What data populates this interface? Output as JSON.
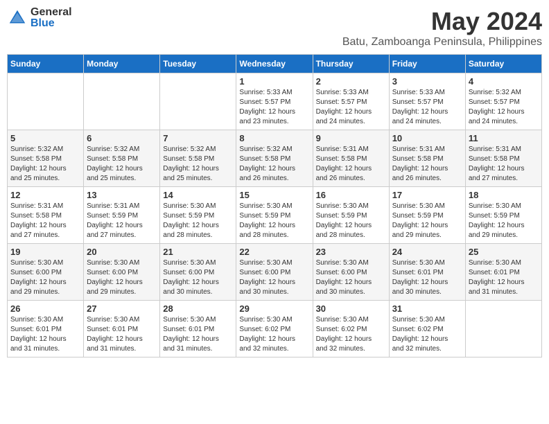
{
  "header": {
    "logo_general": "General",
    "logo_blue": "Blue",
    "month_year": "May 2024",
    "location": "Batu, Zamboanga Peninsula, Philippines"
  },
  "days_of_week": [
    "Sunday",
    "Monday",
    "Tuesday",
    "Wednesday",
    "Thursday",
    "Friday",
    "Saturday"
  ],
  "weeks": [
    [
      {
        "day": "",
        "info": ""
      },
      {
        "day": "",
        "info": ""
      },
      {
        "day": "",
        "info": ""
      },
      {
        "day": "1",
        "info": "Sunrise: 5:33 AM\nSunset: 5:57 PM\nDaylight: 12 hours\nand 23 minutes."
      },
      {
        "day": "2",
        "info": "Sunrise: 5:33 AM\nSunset: 5:57 PM\nDaylight: 12 hours\nand 24 minutes."
      },
      {
        "day": "3",
        "info": "Sunrise: 5:33 AM\nSunset: 5:57 PM\nDaylight: 12 hours\nand 24 minutes."
      },
      {
        "day": "4",
        "info": "Sunrise: 5:32 AM\nSunset: 5:57 PM\nDaylight: 12 hours\nand 24 minutes."
      }
    ],
    [
      {
        "day": "5",
        "info": "Sunrise: 5:32 AM\nSunset: 5:58 PM\nDaylight: 12 hours\nand 25 minutes."
      },
      {
        "day": "6",
        "info": "Sunrise: 5:32 AM\nSunset: 5:58 PM\nDaylight: 12 hours\nand 25 minutes."
      },
      {
        "day": "7",
        "info": "Sunrise: 5:32 AM\nSunset: 5:58 PM\nDaylight: 12 hours\nand 25 minutes."
      },
      {
        "day": "8",
        "info": "Sunrise: 5:32 AM\nSunset: 5:58 PM\nDaylight: 12 hours\nand 26 minutes."
      },
      {
        "day": "9",
        "info": "Sunrise: 5:31 AM\nSunset: 5:58 PM\nDaylight: 12 hours\nand 26 minutes."
      },
      {
        "day": "10",
        "info": "Sunrise: 5:31 AM\nSunset: 5:58 PM\nDaylight: 12 hours\nand 26 minutes."
      },
      {
        "day": "11",
        "info": "Sunrise: 5:31 AM\nSunset: 5:58 PM\nDaylight: 12 hours\nand 27 minutes."
      }
    ],
    [
      {
        "day": "12",
        "info": "Sunrise: 5:31 AM\nSunset: 5:58 PM\nDaylight: 12 hours\nand 27 minutes."
      },
      {
        "day": "13",
        "info": "Sunrise: 5:31 AM\nSunset: 5:59 PM\nDaylight: 12 hours\nand 27 minutes."
      },
      {
        "day": "14",
        "info": "Sunrise: 5:30 AM\nSunset: 5:59 PM\nDaylight: 12 hours\nand 28 minutes."
      },
      {
        "day": "15",
        "info": "Sunrise: 5:30 AM\nSunset: 5:59 PM\nDaylight: 12 hours\nand 28 minutes."
      },
      {
        "day": "16",
        "info": "Sunrise: 5:30 AM\nSunset: 5:59 PM\nDaylight: 12 hours\nand 28 minutes."
      },
      {
        "day": "17",
        "info": "Sunrise: 5:30 AM\nSunset: 5:59 PM\nDaylight: 12 hours\nand 29 minutes."
      },
      {
        "day": "18",
        "info": "Sunrise: 5:30 AM\nSunset: 5:59 PM\nDaylight: 12 hours\nand 29 minutes."
      }
    ],
    [
      {
        "day": "19",
        "info": "Sunrise: 5:30 AM\nSunset: 6:00 PM\nDaylight: 12 hours\nand 29 minutes."
      },
      {
        "day": "20",
        "info": "Sunrise: 5:30 AM\nSunset: 6:00 PM\nDaylight: 12 hours\nand 29 minutes."
      },
      {
        "day": "21",
        "info": "Sunrise: 5:30 AM\nSunset: 6:00 PM\nDaylight: 12 hours\nand 30 minutes."
      },
      {
        "day": "22",
        "info": "Sunrise: 5:30 AM\nSunset: 6:00 PM\nDaylight: 12 hours\nand 30 minutes."
      },
      {
        "day": "23",
        "info": "Sunrise: 5:30 AM\nSunset: 6:00 PM\nDaylight: 12 hours\nand 30 minutes."
      },
      {
        "day": "24",
        "info": "Sunrise: 5:30 AM\nSunset: 6:01 PM\nDaylight: 12 hours\nand 30 minutes."
      },
      {
        "day": "25",
        "info": "Sunrise: 5:30 AM\nSunset: 6:01 PM\nDaylight: 12 hours\nand 31 minutes."
      }
    ],
    [
      {
        "day": "26",
        "info": "Sunrise: 5:30 AM\nSunset: 6:01 PM\nDaylight: 12 hours\nand 31 minutes."
      },
      {
        "day": "27",
        "info": "Sunrise: 5:30 AM\nSunset: 6:01 PM\nDaylight: 12 hours\nand 31 minutes."
      },
      {
        "day": "28",
        "info": "Sunrise: 5:30 AM\nSunset: 6:01 PM\nDaylight: 12 hours\nand 31 minutes."
      },
      {
        "day": "29",
        "info": "Sunrise: 5:30 AM\nSunset: 6:02 PM\nDaylight: 12 hours\nand 32 minutes."
      },
      {
        "day": "30",
        "info": "Sunrise: 5:30 AM\nSunset: 6:02 PM\nDaylight: 12 hours\nand 32 minutes."
      },
      {
        "day": "31",
        "info": "Sunrise: 5:30 AM\nSunset: 6:02 PM\nDaylight: 12 hours\nand 32 minutes."
      },
      {
        "day": "",
        "info": ""
      }
    ]
  ]
}
